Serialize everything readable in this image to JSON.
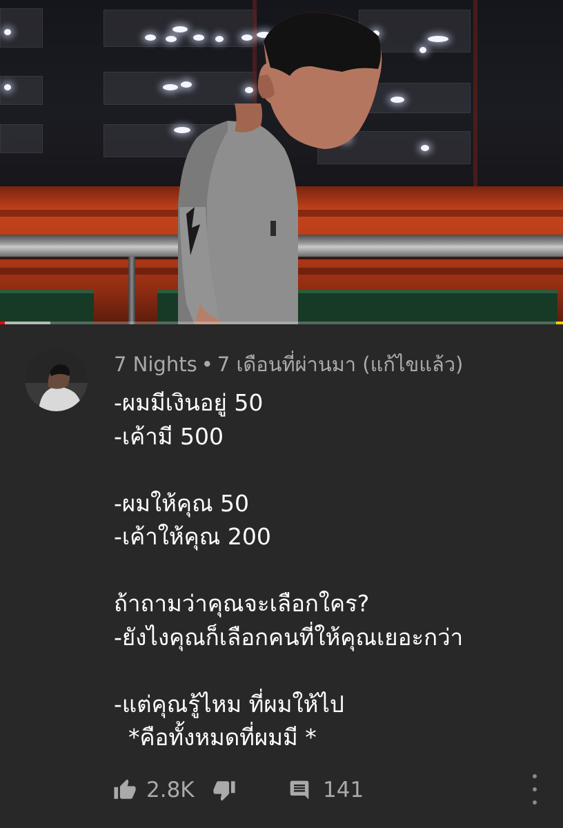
{
  "video": {
    "progress_played": 0.008,
    "progress_buffered": 0.09
  },
  "comment": {
    "author": "7 Nights",
    "separator": "•",
    "time": "7 เดือนที่ผ่านมา (แก้ไขแล้ว)",
    "lines": [
      "-ผมมีเงินอยู่ 50",
      "-เค้ามี 500",
      "",
      "-ผมให้คุณ 50",
      "-เค้าให้คุณ 200",
      "",
      "ถ้าถามว่าคุณจะเลือกใคร?",
      "-ยังไงคุณก็เลือกคนที่ให้คุณเยอะกว่า",
      "",
      "-แต่คุณรู้ไหม ที่ผมให้ไป",
      "  *คือทั้งหมดที่ผมมี *"
    ],
    "likes": "2.8K",
    "replies": "141"
  },
  "icons": {
    "like": "thumbs-up-icon",
    "dislike": "thumbs-down-icon",
    "reply": "comment-icon",
    "more": "more-vert-icon"
  },
  "colors": {
    "background": "#282828",
    "meta_text": "#aaaaaa",
    "progress": "#ff0000"
  }
}
